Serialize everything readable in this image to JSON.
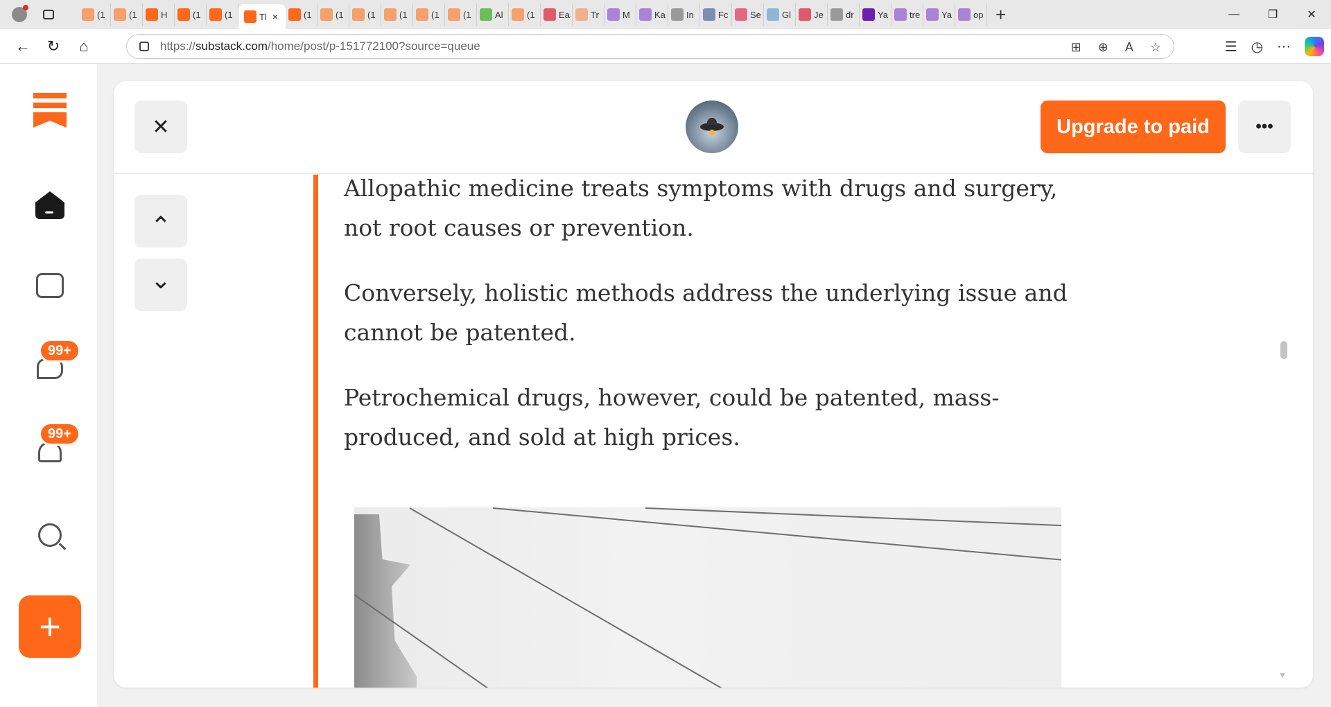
{
  "browser": {
    "tabs": [
      {
        "label": "(1",
        "icon": "substack",
        "color": "#f6a06a"
      },
      {
        "label": "(1",
        "icon": "substack",
        "color": "#f6a06a"
      },
      {
        "label": "H",
        "icon": "substack",
        "color": "#ff6719"
      },
      {
        "label": "(1",
        "icon": "substack",
        "color": "#ff6719"
      },
      {
        "label": "(1",
        "icon": "substack",
        "color": "#ff6719"
      },
      {
        "label": "Tl",
        "icon": "substack",
        "color": "#ff6719",
        "active": true
      },
      {
        "label": "(1",
        "icon": "substack",
        "color": "#ff6719"
      },
      {
        "label": "(1",
        "icon": "substack",
        "color": "#f6a06a"
      },
      {
        "label": "(1",
        "icon": "substack",
        "color": "#f6a06a"
      },
      {
        "label": "(1",
        "icon": "substack",
        "color": "#f6a06a"
      },
      {
        "label": "(1",
        "icon": "substack",
        "color": "#f6a06a"
      },
      {
        "label": "(1",
        "icon": "substack",
        "color": "#f6a06a"
      },
      {
        "label": "Al",
        "icon": "play",
        "color": "#6bbf59"
      },
      {
        "label": "(1",
        "icon": "substack",
        "color": "#f6a06a"
      },
      {
        "label": "Ea",
        "icon": "youtube",
        "color": "#e05a6b"
      },
      {
        "label": "Tr",
        "icon": "circle",
        "color": "#f0b08c"
      },
      {
        "label": "M",
        "icon": "yahoo",
        "color": "#a884d6"
      },
      {
        "label": "Ka",
        "icon": "yahoo",
        "color": "#a884d6"
      },
      {
        "label": "In",
        "icon": "page",
        "color": "#9a9a9a"
      },
      {
        "label": "Fc",
        "icon": "news",
        "color": "#7f8cb0"
      },
      {
        "label": "Se",
        "icon": "shield",
        "color": "#e06a84"
      },
      {
        "label": "Gl",
        "icon": "leaf",
        "color": "#8fb6d6"
      },
      {
        "label": "Je",
        "icon": "youtube",
        "color": "#e05a6b"
      },
      {
        "label": "dr",
        "icon": "search",
        "color": "#9a9a9a"
      },
      {
        "label": "Ya",
        "icon": "yahoo",
        "color": "#6b1fb3"
      },
      {
        "label": "tre",
        "icon": "yahoo",
        "color": "#a884d6"
      },
      {
        "label": "Ya",
        "icon": "yahoo",
        "color": "#a884d6"
      },
      {
        "label": "op",
        "icon": "yahoo",
        "color": "#a884d6"
      }
    ],
    "active_tab_close": "×",
    "new_tab": "+",
    "url_prefix": "https://",
    "url_domain": "substack.com",
    "url_path": "/home/post/p-151772100?source=queue"
  },
  "reader": {
    "close_icon": "✕",
    "prev_icon": "⌃",
    "next_icon": "⌄",
    "upgrade_label": "Upgrade to paid",
    "more_label": "•••",
    "paragraphs": [
      "Allopathic medicine treats symptoms with drugs and surgery, not root causes or prevention.",
      "Conversely, holistic methods address the underlying issue and cannot be patented.",
      "Petrochemical drugs, however, could be patented, mass-produced, and sold at high prices."
    ]
  },
  "sidebar": {
    "chat_badge": "99+",
    "notifications_badge": "99+",
    "create_label": "+"
  },
  "colors": {
    "brand": "#ff6719",
    "text": "#333333"
  }
}
